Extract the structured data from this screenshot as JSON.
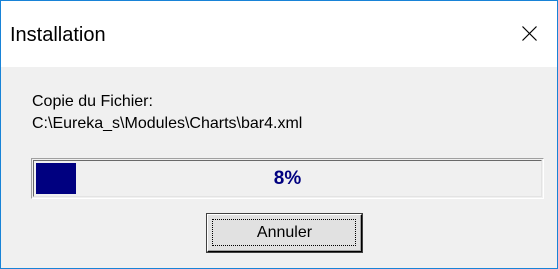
{
  "window": {
    "title": "Installation",
    "accent_border_color": "#1883d7",
    "close_icon": "close-icon"
  },
  "message": {
    "line1": "Copie du Fichier:",
    "line2": "C:\\Eureka_s\\Modules\\Charts\\bar4.xml"
  },
  "progress": {
    "percent": 8,
    "label": "8%",
    "fill_color": "#000080"
  },
  "buttons": {
    "cancel_label": "Annuler"
  }
}
